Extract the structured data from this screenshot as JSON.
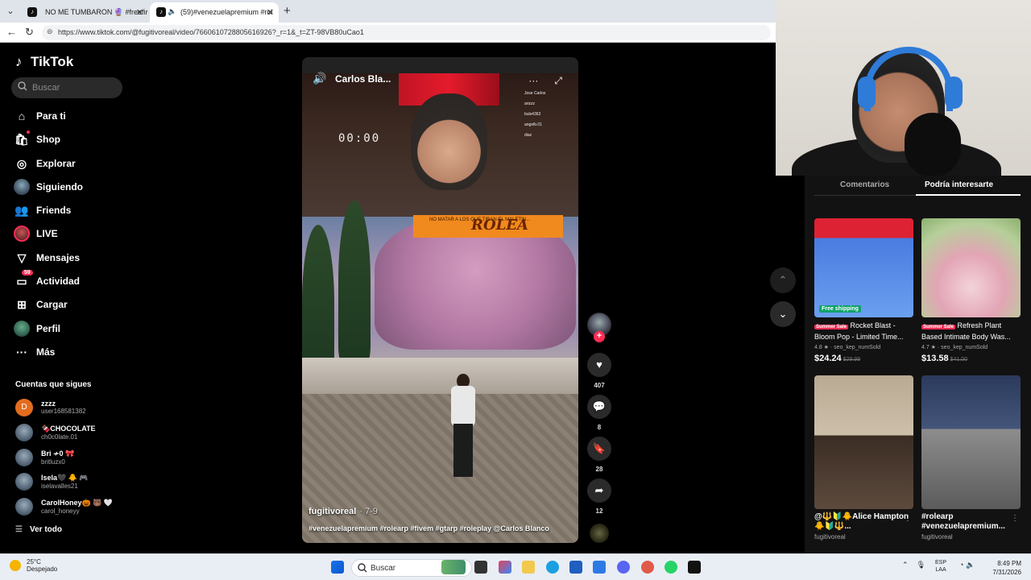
{
  "browser": {
    "tabs": [
      {
        "label": "NO ME TUMBARON 🔮 #freefire"
      },
      {
        "label": "(59)#venezuelapremium #rol",
        "active": true
      }
    ],
    "url": "https://www.tiktok.com/@fugitivoreal/video/7660610728805616926?_r=1&_t=ZT-98VB80uCao1"
  },
  "sidebar": {
    "logo": "TikTok",
    "search_placeholder": "Buscar",
    "items": [
      {
        "label": "Para ti",
        "icon": "home-icon"
      },
      {
        "label": "Shop",
        "icon": "shop-bag-icon"
      },
      {
        "label": "Explorar",
        "icon": "compass-icon"
      },
      {
        "label": "Siguiendo",
        "icon": "following-avatar-icon"
      },
      {
        "label": "Friends",
        "icon": "friends-icon"
      },
      {
        "label": "LIVE",
        "icon": "live-icon"
      },
      {
        "label": "Mensajes",
        "icon": "send-icon"
      },
      {
        "label": "Actividad",
        "icon": "inbox-icon",
        "badge": "59"
      },
      {
        "label": "Cargar",
        "icon": "upload-icon"
      },
      {
        "label": "Perfil",
        "icon": "profile-avatar-icon"
      },
      {
        "label": "Más",
        "icon": "more-icon"
      }
    ],
    "following_title": "Cuentas que sigues",
    "following": [
      {
        "name": "zzzz",
        "user": "user168581382"
      },
      {
        "name": "🍫CHOCOLATE",
        "user": "ch0c0late.01"
      },
      {
        "name": "Bri ≁0 🎀",
        "user": "britluzx0"
      },
      {
        "name": "Isela🖤 🐥 🎮",
        "user": "iselavalles21"
      },
      {
        "name": "CarolHoney🎃 🐻 🤍",
        "user": "carol_honeyy"
      }
    ],
    "see_all": "Ver todo"
  },
  "video": {
    "author_top": "Carlos Bla...",
    "timer": "00:00",
    "leaderboard": [
      "Jose Carlos",
      "arizzz",
      "buls4363",
      "angelb.01",
      "diaz"
    ],
    "banner_text": "NO MATAR A LOS QUE TIRAN EL MALETIN...",
    "banner_logo": "ROLEA",
    "author": "fugitivoreal",
    "ago": "· 7-9",
    "caption": "#venezuelapremium #rolearp #fivem #gtarp #roleplay @Carlos Blanco"
  },
  "actions": {
    "likes": "407",
    "comments": "8",
    "saves": "28",
    "shares": "12"
  },
  "right_panel": {
    "tabs": [
      "Comentarios",
      "Podría interesarte"
    ],
    "products": [
      {
        "tag": "Summer Sale",
        "title": "Rocket Blast - Bloom Pop - Limited Time...",
        "rating": "4.8 ★",
        "sold": "· seo_kep_numSold",
        "price": "$24.24",
        "old_price": "$29.99",
        "shipping": "Free shipping"
      },
      {
        "tag": "Summer Sale",
        "title": "Refresh Plant Based Intimate Body Was...",
        "rating": "4.7 ★",
        "sold": "· seo_kep_numSold",
        "price": "$13.58",
        "old_price": "$41.00"
      }
    ],
    "videos": [
      {
        "title": "@🔱🔰🐥Alice Hampton🐥🔰🔱...",
        "user": "fugitivoreal"
      },
      {
        "title": "#rolearp #venezuelapremium...",
        "user": "fugitivoreal"
      }
    ]
  },
  "taskbar": {
    "temp": "25°C",
    "weather": "Despejado",
    "search": "Buscar",
    "lang1": "ESP",
    "lang2": "LAA",
    "time": "8:49 PM",
    "date": "7/31/2026"
  }
}
